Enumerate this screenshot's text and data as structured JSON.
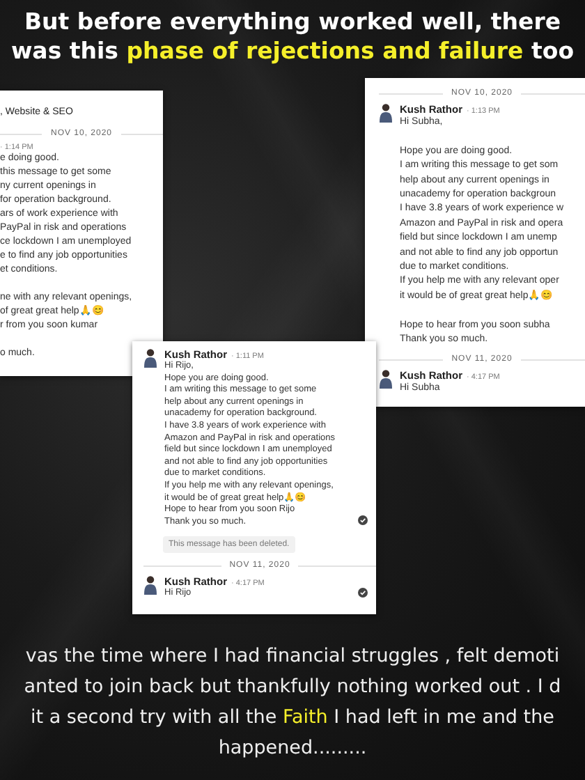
{
  "headline": "But before everything worked well, there was this **phase of rejections and failure** too",
  "screenshots": [
    {
      "items": [
        {
          "kind": "header",
          "text": ", Website & SEO"
        },
        {
          "kind": "date",
          "text": "NOV 10, 2020"
        },
        {
          "kind": "message",
          "avatar": false,
          "time": "· 1:14 PM",
          "read": false,
          "paragraphs": [
            "e doing good.\nthis message to get some\nny current openings in\nfor operation background.\nars of work experience with\nPayPal in risk and operations\nce lockdown I am unemployed\ne to find any job opportunities\net conditions.",
            "ne with any relevant openings,\nof great great help🙏😊\nr from you soon kumar",
            "o much."
          ]
        }
      ]
    },
    {
      "items": [
        {
          "kind": "date",
          "text": "NOV 10, 2020"
        },
        {
          "kind": "message",
          "avatar": true,
          "author": "Kush Rathor",
          "time": "· 1:13 PM",
          "read": false,
          "paragraphs": [
            "Hi Subha,",
            "Hope you are doing good.\nI am writing this message to get som\nhelp about any current openings in\nunacademy for operation backgroun\nI have 3.8 years of work experience w\nAmazon and PayPal in risk and opera\nfield but since lockdown I am unemp\nand not able to find any job opportun\ndue to market conditions.\nIf you help me with any relevant oper\nit would be of great great help🙏😊",
            "Hope to hear from you soon subha\nThank you so much."
          ]
        },
        {
          "kind": "date",
          "text": "NOV 11, 2020"
        },
        {
          "kind": "message",
          "avatar": true,
          "author": "Kush Rathor",
          "time": "· 4:17 PM",
          "read": false,
          "paragraphs": [
            "Hi Subha"
          ]
        }
      ]
    },
    {
      "items": [
        {
          "kind": "message",
          "avatar": true,
          "author": "Kush Rathor",
          "time": "· 1:11 PM",
          "read": true,
          "paragraphs": [
            "Hi Rijo,\nHope you are doing good.\nI am writing this message to get some\nhelp about any current openings in\nunacademy for operation background.\nI have 3.8 years of work experience with\nAmazon and PayPal in risk and operations\nfield but since lockdown I am unemployed\nand not able to find any job opportunities\ndue to market conditions.\nIf you help me with any relevant openings,\nit would be of great great help🙏😊\nHope to hear from you soon Rijo\nThank you so much."
          ]
        },
        {
          "kind": "deleted",
          "text": "This message has been deleted."
        },
        {
          "kind": "date",
          "text": "NOV 11, 2020"
        },
        {
          "kind": "message",
          "avatar": true,
          "author": "Kush Rathor",
          "time": "· 4:17 PM",
          "read": true,
          "paragraphs": [
            "Hi Rijo"
          ]
        }
      ]
    }
  ],
  "story": "vas the time where I had financial struggles , felt demoti\nanted to join back but thankfully nothing worked out . I d\nit a second try with all the **Faith** I had left in me and the\nhappened........."
}
